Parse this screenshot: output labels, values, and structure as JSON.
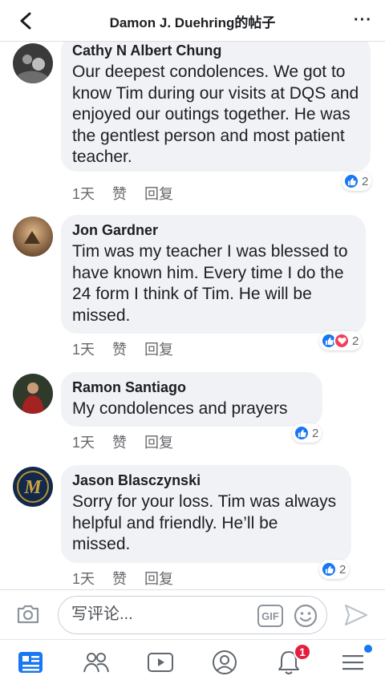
{
  "header": {
    "title": "Damon J. Duehring的帖子"
  },
  "comments": [
    {
      "author": "Cathy N Albert Chung",
      "text": "Our deepest condolences.  We got to know Tim during our visits at DQS and enjoyed our outings together.  He was the gentlest person and most patient teacher.",
      "time": "1天",
      "like": "赞",
      "reply": "回复",
      "reaction_count": "2"
    },
    {
      "author": "Jon Gardner",
      "text": "Tim was my teacher I was blessed to have known him.  Every time I do the 24 form I think of Tim.  He will be missed.",
      "time": "1天",
      "like": "赞",
      "reply": "回复",
      "reaction_count": "2"
    },
    {
      "author": "Ramon Santiago",
      "text": "My condolences and prayers",
      "time": "1天",
      "like": "赞",
      "reply": "回复",
      "reaction_count": "2"
    },
    {
      "author": "Jason Blasczynski",
      "text": "Sorry for your loss. Tim was always helpful and friendly. He’ll be missed.",
      "time": "1天",
      "like": "赞",
      "reply": "回复",
      "reaction_count": "2"
    }
  ],
  "composer": {
    "placeholder": "写评论...",
    "gif_label": "GIF"
  },
  "nav": {
    "notifications_badge": "1"
  },
  "colors": {
    "accent": "#1877f2",
    "love": "#f33e58",
    "badge": "#e41e3f",
    "bubble": "#f0f2f5"
  }
}
